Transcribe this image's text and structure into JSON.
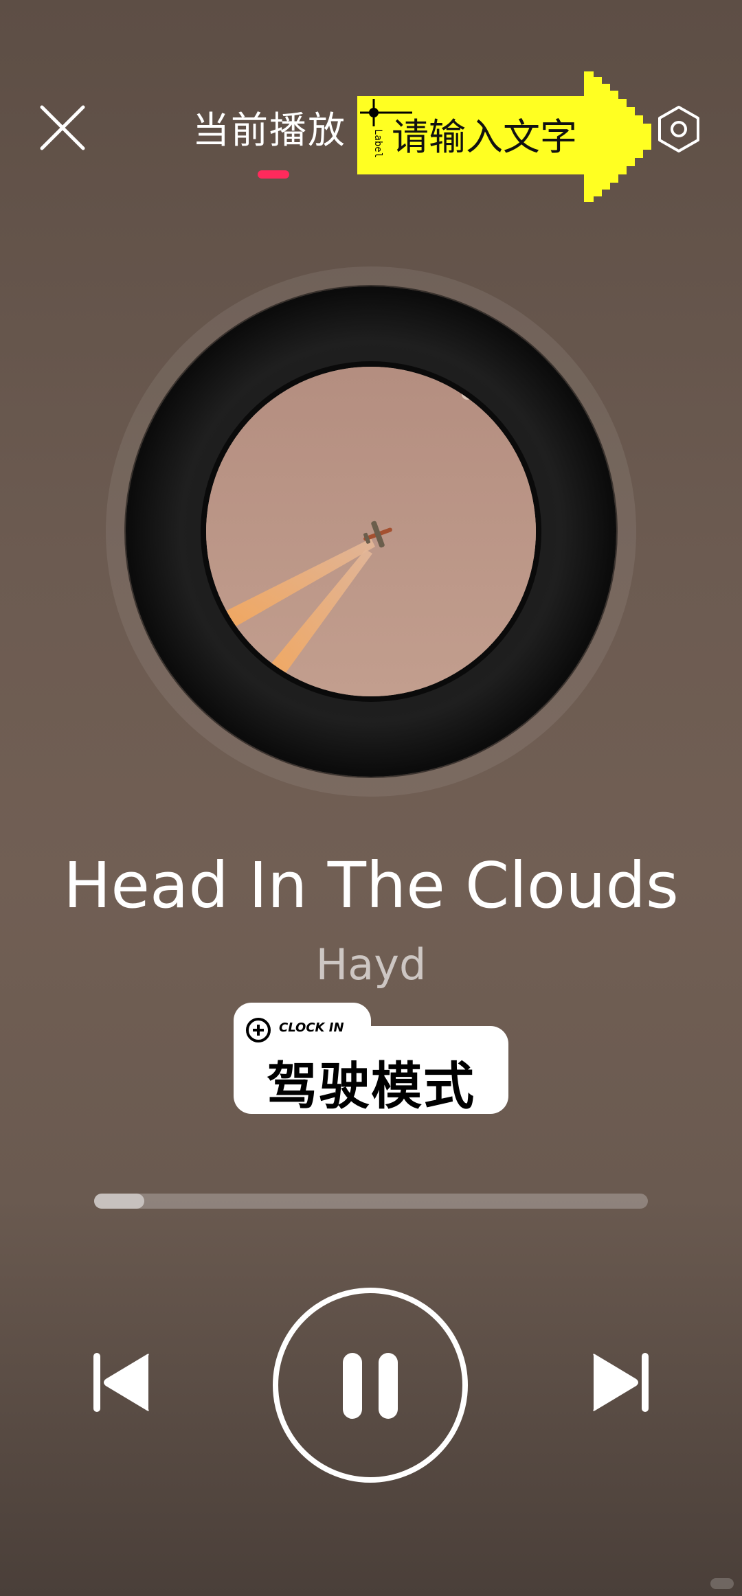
{
  "header": {
    "close_icon": "close-icon",
    "tab_title": "当前播放",
    "settings_icon": "hexagon-settings-icon",
    "accent": "#ff2a5c"
  },
  "sticker": {
    "text": "请输入文字",
    "tag": "Label",
    "color": "#ffff22"
  },
  "album": {
    "art_description": "airplane-with-contrails"
  },
  "track": {
    "title": "Head In The Clouds",
    "artist": "Hayd"
  },
  "mode_sticker": {
    "small_label": "CLOCK IN",
    "title": "驾驶模式"
  },
  "progress": {
    "fraction": 0.09
  },
  "controls": {
    "prev_icon": "skip-previous-icon",
    "play_icon": "pause-icon",
    "next_icon": "skip-next-icon"
  }
}
